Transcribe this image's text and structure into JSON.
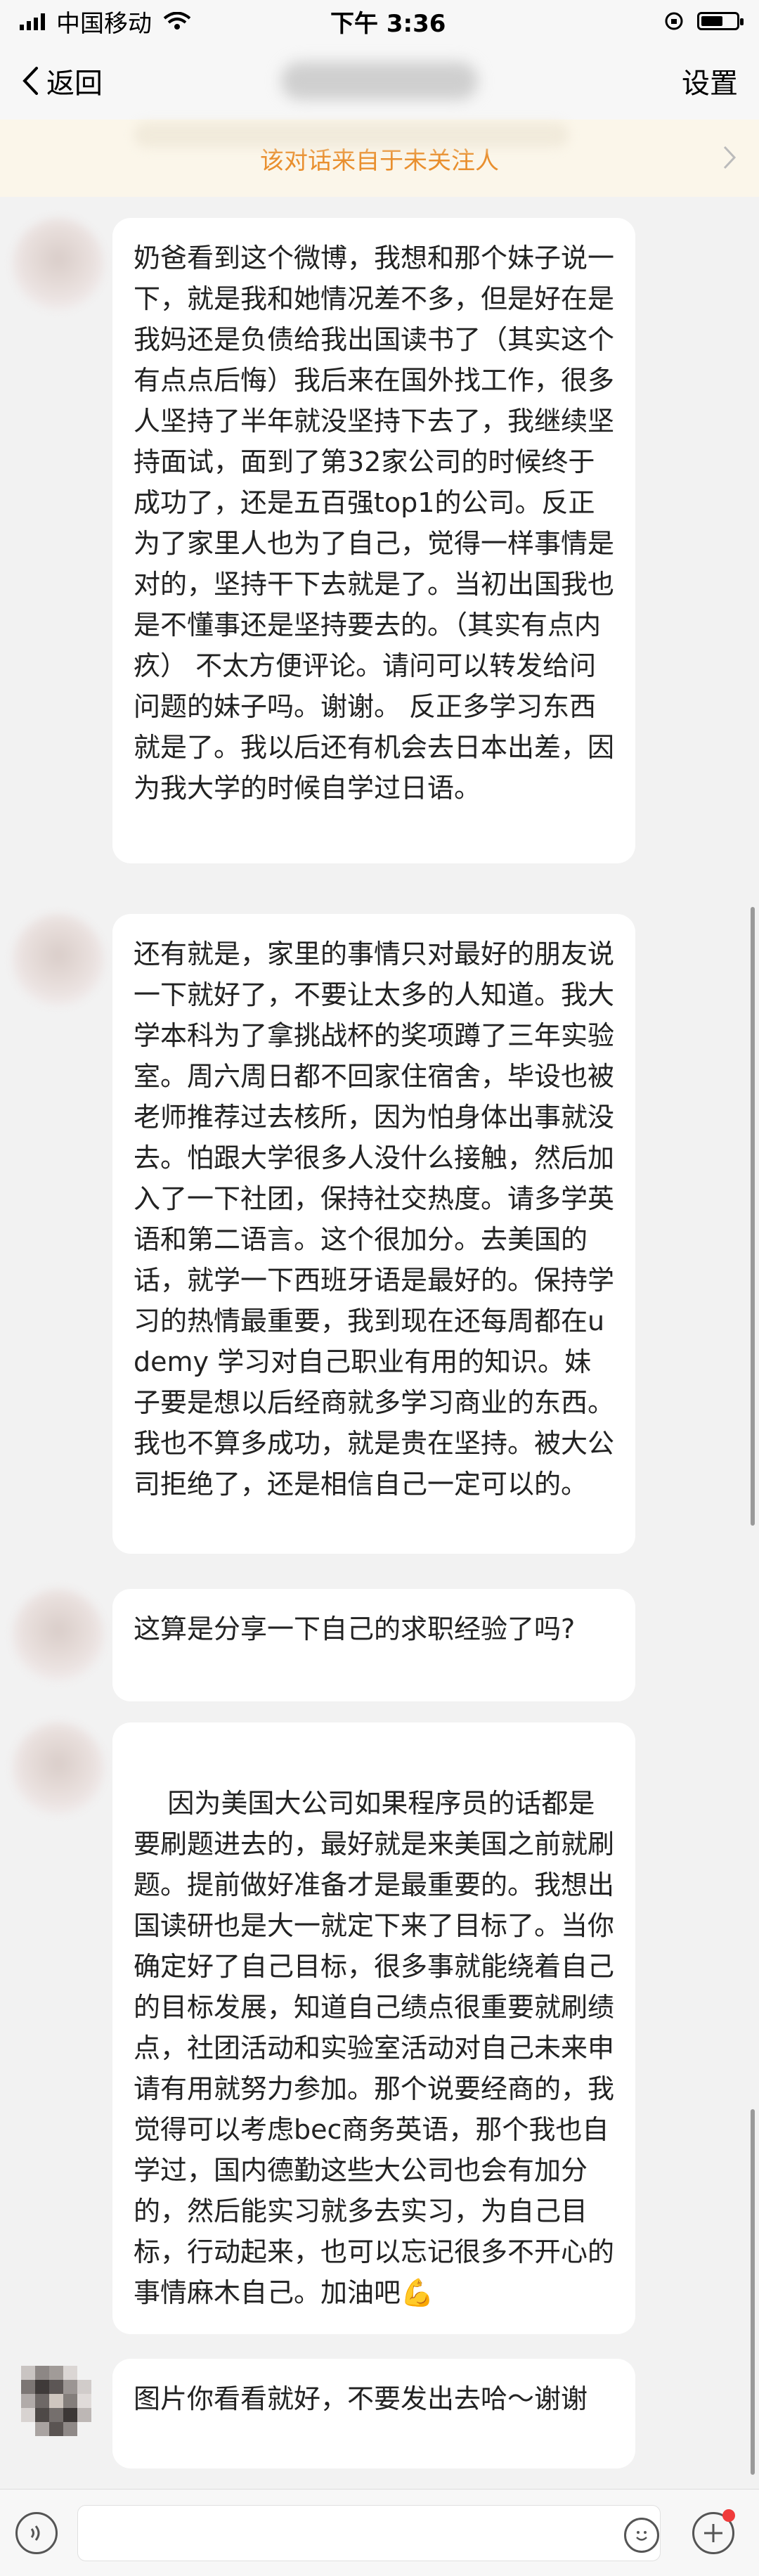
{
  "status_bar": {
    "carrier": "中国移动",
    "time": "下午 3:36"
  },
  "nav": {
    "back_label": "返回",
    "settings_label": "设置"
  },
  "notice": {
    "text": "该对话来自于未关注人"
  },
  "messages": [
    {
      "text": "奶爸看到这个微博，我想和那个妹子说一下，就是我和她情况差不多，但是好在是我妈还是负债给我出国读书了（其实这个有点点后悔）我后来在国外找工作，很多人坚持了半年就没坚持下去了，我继续坚持面试，面到了第32家公司的时候终于成功了，还是五百强top1的公司。反正为了家里人也为了自己，觉得一样事情是对的，坚持干下去就是了。当初出国我也是不懂事还是坚持要去的。（其实有点内疚） 不太方便评论。请问可以转发给问问题的妹子吗。谢谢。 反正多学习东西就是了。我以后还有机会去日本出差，因为我大学的时候自学过日语。"
    },
    {
      "text": "还有就是，家里的事情只对最好的朋友说一下就好了，不要让太多的人知道。我大学本科为了拿挑战杯的奖项蹲了三年实验室。周六周日都不回家住宿舍，毕设也被老师推荐过去核所，因为怕身体出事就没去。怕跟大学很多人没什么接触，然后加入了一下社团，保持社交热度。请多学英语和第二语言。这个很加分。去美国的话，就学一下西班牙语是最好的。保持学习的热情最重要，我到现在还每周都在udemy 学习对自己职业有用的知识。妹子要是想以后经商就多学习商业的东西。我也不算多成功，就是贵在坚持。被大公司拒绝了，还是相信自己一定可以的。"
    },
    {
      "text": "这算是分享一下自己的求职经验了吗?"
    },
    {
      "text": "因为美国大公司如果程序员的话都是要刷题进去的，最好就是来美国之前就刷题。提前做好准备才是最重要的。我想出国读研也是大一就定下来了目标了。当你确定好了自己目标，很多事就能绕着自己的目标发展，知道自己绩点很重要就刷绩点，社团活动和实验室活动对自己未来申请有用就努力参加。那个说要经商的，我觉得可以考虑bec商务英语，那个我也自学过，国内德勤这些大公司也会有加分的，然后能实习就多去实习，为自己目标，行动起来，也可以忘记很多不开心的事情麻木自己。加油吧",
      "emoji": "💪"
    },
    {
      "text": "图片你看看就好，不要发出去哈～谢谢"
    }
  ],
  "colors": {
    "accent": "#e98f2e",
    "background": "#f2f2f2",
    "bubble": "#ffffff"
  }
}
